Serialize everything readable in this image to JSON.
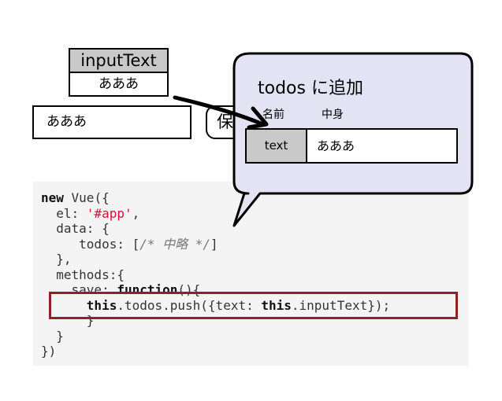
{
  "variable": {
    "name": "inputText",
    "value": "あああ"
  },
  "form": {
    "input_value": "あああ",
    "save_label": "保存"
  },
  "popup": {
    "title": "todos に追加",
    "columns": [
      "名前",
      "中身"
    ],
    "row": {
      "key": "text",
      "value": "あああ"
    }
  },
  "code": {
    "lines": [
      [
        {
          "t": "new",
          "c": "kw"
        },
        {
          "t": " Vue({"
        }
      ],
      [
        {
          "t": "  el: "
        },
        {
          "t": "'#app'",
          "c": "str"
        },
        {
          "t": ","
        }
      ],
      [
        {
          "t": "  data: {"
        }
      ],
      [
        {
          "t": "     todos: ["
        },
        {
          "t": "/* 中略 */",
          "c": "cm"
        },
        {
          "t": "]"
        }
      ],
      [
        {
          "t": "  },"
        }
      ],
      [
        {
          "t": "  methods:{"
        }
      ],
      [
        {
          "t": "    save: "
        },
        {
          "t": "function",
          "c": "kw"
        },
        {
          "t": "(){"
        }
      ],
      [
        {
          "t": "      "
        },
        {
          "t": "this",
          "c": "kw"
        },
        {
          "t": ".todos.push({text: "
        },
        {
          "t": "this",
          "c": "kw"
        },
        {
          "t": ".inputText});"
        }
      ],
      [
        {
          "t": "      }"
        }
      ],
      [
        {
          "t": "  }"
        }
      ],
      [
        {
          "t": "})"
        }
      ]
    ]
  },
  "colors": {
    "highlight": "#8e2028",
    "popup_fill": "#e3e3f3",
    "cell_key_fill": "#c9c9c9",
    "code_bg": "#f4f4f4"
  }
}
